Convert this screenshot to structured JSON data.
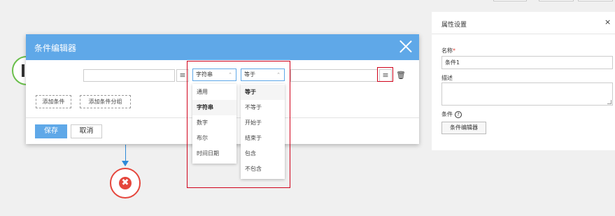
{
  "dialog": {
    "title": "条件编辑器",
    "add_condition": "添加条件",
    "add_condition_group": "添加条件分组",
    "save": "保存",
    "cancel": "取消"
  },
  "condition_row": {
    "field_value": "",
    "value_input": "",
    "type_select": {
      "selected": "字符串",
      "options": [
        "通用",
        "字符串",
        "数字",
        "布尔",
        "时间日期"
      ]
    },
    "operator_select": {
      "selected": "等于",
      "options": [
        "等于",
        "不等于",
        "开始于",
        "结束于",
        "包含",
        "不包含"
      ]
    }
  },
  "panel": {
    "title": "属性设置",
    "close": "×",
    "name_label": "名称",
    "required_mark": "*",
    "name_value": "条件1",
    "desc_label": "描述",
    "desc_value": "",
    "condition_label": "条件",
    "help_glyph": "?",
    "editor_button": "条件编辑器"
  },
  "icons": {
    "list": "≡",
    "trash": "🗑",
    "end_x": "✖",
    "caret_up": "⌃"
  },
  "colors": {
    "accent": "#5fa8e8",
    "highlight": "#d0021b",
    "start": "#6abf4b",
    "end": "#e5463c"
  }
}
